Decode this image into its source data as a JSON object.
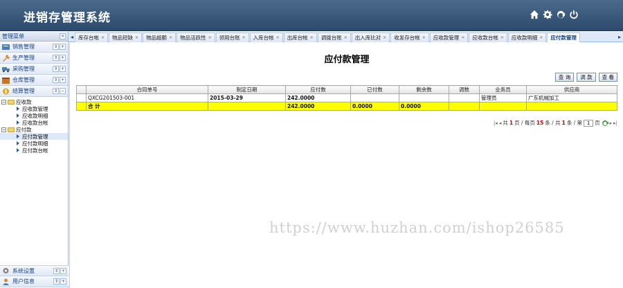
{
  "header": {
    "title": "进销存管理系统",
    "icons": [
      "home-icon",
      "gear-icon",
      "refresh-icon",
      "power-icon"
    ]
  },
  "sidebar": {
    "title": "管理菜单",
    "collapse_glyph": "«",
    "groups": [
      {
        "label": "销售管理"
      },
      {
        "label": "生产管理"
      },
      {
        "label": "采购管理"
      },
      {
        "label": "仓库管理"
      },
      {
        "label": "结算管理"
      }
    ],
    "tree": {
      "receivable": {
        "label": "应收款",
        "children": [
          "应收款管理",
          "应收款明细",
          "应收款台帐"
        ]
      },
      "payable": {
        "label": "应付款",
        "children": [
          "应付款管理",
          "应付款明细",
          "应付款台帐"
        ]
      }
    },
    "bottom_groups": [
      {
        "label": "系统设置"
      },
      {
        "label": "用户信息"
      }
    ]
  },
  "tabs": [
    "库存台帐",
    "物品短缺",
    "物品超额",
    "物品活跃性",
    "领用台账",
    "入库台帐",
    "出库台帐",
    "调拨台账",
    "出入库比对",
    "收发存台帐",
    "应收款管理",
    "应收款台帐",
    "应收款明细",
    "应付款管理"
  ],
  "active_tab": "应付款管理",
  "main": {
    "page_title": "应付款管理",
    "toolbar": {
      "query": "查 询",
      "adjust": "调 款",
      "view": "查 看"
    },
    "columns": [
      "合同单号",
      "制定日期",
      "应付数",
      "已付数",
      "剩余数",
      "调数",
      "业务员",
      "供应商"
    ],
    "rows": [
      [
        "QXCG201503-001",
        "2015-03-29",
        "242.0000",
        "",
        "",
        "",
        "管理员",
        "广东机械加工"
      ]
    ],
    "total_row": [
      "合 计",
      "",
      "242.0000",
      "0.0000",
      "0.0000",
      "",
      "",
      ""
    ],
    "pager": {
      "prefix": "共",
      "page_count": "1",
      "per_page_label": "页 / 每页",
      "per_page": "15",
      "items_label": "条 / 共",
      "item_count": "1",
      "page_label": "条 / 第",
      "current_page": "1",
      "page_suffix": "页"
    }
  },
  "watermark": "https://www.huzhan.com/ishop26585"
}
